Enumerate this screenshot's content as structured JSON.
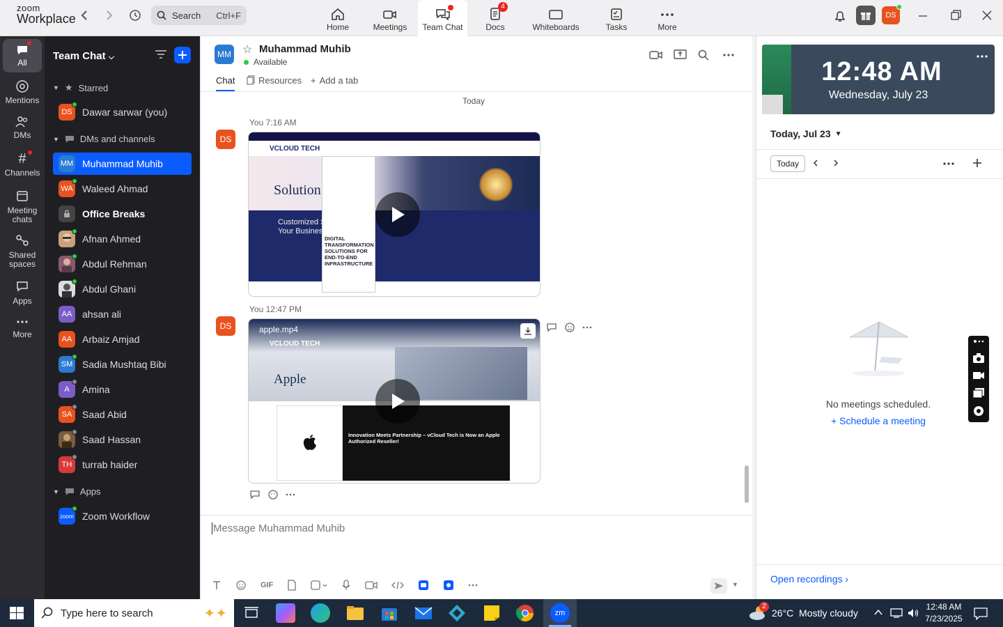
{
  "app": {
    "logo_line1": "zoom",
    "logo_line2": "Workplace"
  },
  "search": {
    "placeholder": "Search",
    "shortcut": "Ctrl+F"
  },
  "tabs": [
    {
      "label": "Home",
      "icon": "home-icon"
    },
    {
      "label": "Meetings",
      "icon": "video-icon"
    },
    {
      "label": "Team Chat",
      "icon": "chat-icon",
      "active": true
    },
    {
      "label": "Docs",
      "icon": "docs-icon",
      "badge": "4"
    },
    {
      "label": "Whiteboards",
      "icon": "whiteboard-icon"
    },
    {
      "label": "Tasks",
      "icon": "tasks-icon"
    },
    {
      "label": "More",
      "icon": "more-icon"
    }
  ],
  "user_avatar": "DS",
  "leftnav": [
    {
      "label": "All"
    },
    {
      "label": "Mentions"
    },
    {
      "label": "DMs"
    },
    {
      "label": "Channels"
    },
    {
      "label": "Meeting chats"
    },
    {
      "label": "Shared spaces"
    },
    {
      "label": "Apps"
    },
    {
      "label": "More"
    }
  ],
  "sidebar": {
    "title": "Team Chat",
    "starred_label": "Starred",
    "starred": [
      {
        "initials": "DS",
        "name": "Dawar sarwar (you)",
        "color": "#e8521f"
      }
    ],
    "dms_label": "DMs and channels",
    "dms": [
      {
        "initials": "MM",
        "name": "Muhammad Muhib",
        "color": "#2a7bd1"
      },
      {
        "initials": "WA",
        "name": "Waleed Ahmad",
        "color": "#e8521f"
      },
      {
        "initials": "",
        "name": "Office Breaks",
        "color": "#444"
      },
      {
        "initials": "",
        "name": "Afnan Ahmed",
        "color": "#c9a27a"
      },
      {
        "initials": "",
        "name": "Abdul Rehman",
        "color": "#8a5a6a"
      },
      {
        "initials": "",
        "name": "Abdul Ghani",
        "color": "#ddd"
      },
      {
        "initials": "AA",
        "name": "ahsan ali",
        "color": "#7d5cc7"
      },
      {
        "initials": "AA",
        "name": "Arbaiz Amjad",
        "color": "#e8521f"
      },
      {
        "initials": "SM",
        "name": "Sadia Mushtaq Bibi",
        "color": "#2a7bd1"
      },
      {
        "initials": "A",
        "name": "Amina",
        "color": "#7d5cc7"
      },
      {
        "initials": "SA",
        "name": "Saad Abid",
        "color": "#e8521f"
      },
      {
        "initials": "",
        "name": "Saad Hassan",
        "color": "#7a5c3c"
      },
      {
        "initials": "TH",
        "name": "turrab haider",
        "color": "#d63a3a"
      }
    ],
    "apps_label": "Apps",
    "apps": [
      {
        "initials": "zoom",
        "name": "Zoom Workflow",
        "color": "#0b5cff"
      }
    ]
  },
  "chat": {
    "contact_initials": "MM",
    "contact_name": "Muhammad Muhib",
    "status": "Available",
    "tabs": [
      "Chat",
      "Resources",
      "Add a tab"
    ],
    "date_divider": "Today",
    "messages": [
      {
        "sender": "You",
        "time": "7:16 AM",
        "avatar": "DS",
        "preview": {
          "brand": "VCLOUD TECH",
          "headline": "Solution",
          "sub": "Customized S\nYour Business",
          "menu_title": "DIGITAL TRANSFORMATION SOLUTIONS FOR END-TO-END INFRASTRUCTURE"
        }
      },
      {
        "sender": "You",
        "time": "12:47 PM",
        "avatar": "DS",
        "filename": "apple.mp4",
        "preview": {
          "brand": "VCLOUD TECH",
          "headline": "Apple",
          "card_title": "Innovation Meets Partnership – vCloud Tech is Now an Apple Authorized Reseller!"
        }
      }
    ],
    "composer_placeholder": "Message Muhammad Muhib"
  },
  "right_panel": {
    "clock_time": "12:48 AM",
    "clock_date": "Wednesday, July 23",
    "date_header": "Today, Jul 23",
    "today_button": "Today",
    "empty_text": "No meetings scheduled.",
    "schedule_link": "Schedule a meeting",
    "open_recordings": "Open recordings"
  },
  "taskbar": {
    "search_placeholder": "Type here to search",
    "weather": "26°C  Mostly cloudy",
    "weather_badge": "2",
    "time": "12:48 AM",
    "date": "7/23/2025"
  },
  "colors": {
    "accent": "#0b5cff",
    "sidebar_bg": "#1f1f23",
    "nav_bg": "#2b2b30",
    "alert": "#e22222"
  }
}
